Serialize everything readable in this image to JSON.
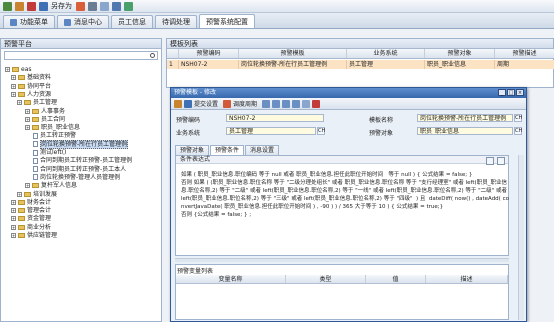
{
  "toolbar": {
    "save_as": "另存为"
  },
  "tabs": [
    {
      "label": "功能菜单"
    },
    {
      "label": "消息中心"
    },
    {
      "label": "员工信息"
    },
    {
      "label": "待调处理"
    },
    {
      "label": "预警系统配置"
    }
  ],
  "left_panel": {
    "title": "预警平台",
    "tree": [
      {
        "label": "eas"
      },
      {
        "label": "基础资料"
      },
      {
        "label": "协同平台"
      },
      {
        "label": "人力资源"
      },
      {
        "label": "员工管理"
      },
      {
        "label": "人事事务"
      },
      {
        "label": "员工合同"
      },
      {
        "label": "职员_职业信息"
      },
      {
        "label": "员工转正预警"
      },
      {
        "label": "岗位轮换预警-所在行员工管理例"
      },
      {
        "label": "测试left()"
      },
      {
        "label": "合同到期员工转正预警-员工管理例"
      },
      {
        "label": "合同到期员工转正预警-员工本人"
      },
      {
        "label": "岗位轮换预警-管理人员管理例"
      },
      {
        "label": "复杆军人信息"
      },
      {
        "label": "培训发展"
      },
      {
        "label": "财务会计"
      },
      {
        "label": "管理会计"
      },
      {
        "label": "资金管理"
      },
      {
        "label": "商业分析"
      },
      {
        "label": "供应链管理"
      }
    ]
  },
  "template_list": {
    "title": "模板列表",
    "columns": [
      "",
      "预警编码",
      "预警模板",
      "业务系统",
      "预警对象",
      "预警描述"
    ],
    "rows": [
      [
        "1",
        "NSH07-2",
        "岗位轮换预警-所在行员工管理例",
        "员工管理",
        "职员_职业信息",
        "周期"
      ]
    ]
  },
  "dialog": {
    "title": "预警模板 - 修改",
    "toolbar": {
      "save": "提交设置",
      "select": "调度周期"
    },
    "fields": {
      "code_label": "预警编码",
      "code": "NSH07-2",
      "business_label": "业务系统",
      "business": "员工管理",
      "name_label": "模板名称",
      "name": "岗位轮换预警-所在行员工管理例",
      "object_label": "预警对象",
      "object": "职员_职业信息"
    },
    "tabs": [
      {
        "label": "预警对象"
      },
      {
        "label": "预警条件"
      },
      {
        "label": "消息设置"
      }
    ],
    "condition_title": "条件表达式",
    "condition_text": "如果 ( 职员_职业信息.职位编码 等于 null 或者 职员_职业信息.担任此职位开始时间   等于 null ) { 公式结果 = false; }\n否则 如果 ( (职员_职业信息.职位名称 等于 \"二级分理处组长\" 或者 职员_职业信息.职位名称 等于 \"支行经理室\" 或者 left(职员_职业信息.职位名称,2) 等于 \"二级\" 或者 left(职员_职业信息.职位名称,2) 等于 \"一线\" 或者 left(职员_职业信息.职位名称,2) 等于 \"二级\" 或者 left(职员_职业信息.职位名称,2) 等于 \"三级\" 或者 left(职员_职业信息.职位名称,2) 等于 \"四级\"  ) 且  dateDiff( now() , dateAdd( convertJavaDate( 职员_职业信息.担任此职位开始时间 ) , -90 ) ) / 365 大于等于 10 ) { 公式结果 = true;}\n否则 {公式结果 = false; } ;",
    "vars_title": "预警变量列表",
    "vars_columns": [
      "变量名称",
      "类型",
      "值",
      "描述"
    ]
  }
}
